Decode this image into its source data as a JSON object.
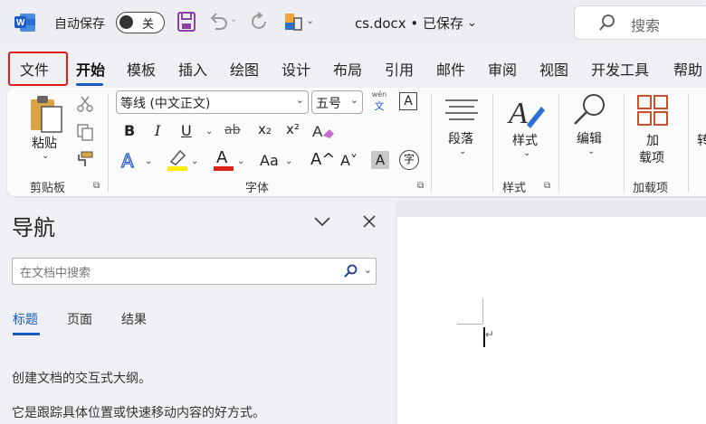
{
  "titlebar": {
    "autosave_label": "自动保存",
    "autosave_state": "关",
    "doc_title": "cs.docx • 已保存",
    "search_placeholder": "搜索"
  },
  "tabs": [
    "文件",
    "开始",
    "模板",
    "插入",
    "绘图",
    "设计",
    "布局",
    "引用",
    "邮件",
    "审阅",
    "视图",
    "开发工具",
    "帮助"
  ],
  "active_tab": "开始",
  "ribbon": {
    "paste_label": "粘贴",
    "clipboard_group": "剪贴板",
    "font_name": "等线 (中文正文)",
    "font_size": "五号",
    "font_group": "字体",
    "phonetic_top": "wén",
    "phonetic_bottom": "文",
    "border_char": "A",
    "bold": "B",
    "italic": "I",
    "underline": "U",
    "strike": "ab",
    "subscript": "x₂",
    "superscript": "x²",
    "effects": "A",
    "highlight": "A",
    "font_color": "A",
    "change_case": "Aa",
    "grow": "A^",
    "shrink": "A˅",
    "shading": "A",
    "enclosed": "字",
    "paragraph_label": "段落",
    "styles_label": "样式",
    "styles_group": "样式",
    "editing_label": "编辑",
    "addin_label_1": "加",
    "addin_label_2": "载项",
    "addin_group": "加载项",
    "cut_off": "转"
  },
  "nav": {
    "title": "导航",
    "search_placeholder": "在文档中搜索",
    "tabs": [
      "标题",
      "页面",
      "结果"
    ],
    "active_tab": "标题",
    "desc1": "创建文档的交互式大纲。",
    "desc2": "它是跟踪具体位置或快速移动内容的好方式。"
  },
  "colors": {
    "accent": "#185abd",
    "highlight_bar": "#ffee00",
    "font_color_bar": "#e0201b",
    "file_box": "#e01b1b",
    "word_blue": "#1e5bc6",
    "save_purple": "#8b3fa8"
  }
}
